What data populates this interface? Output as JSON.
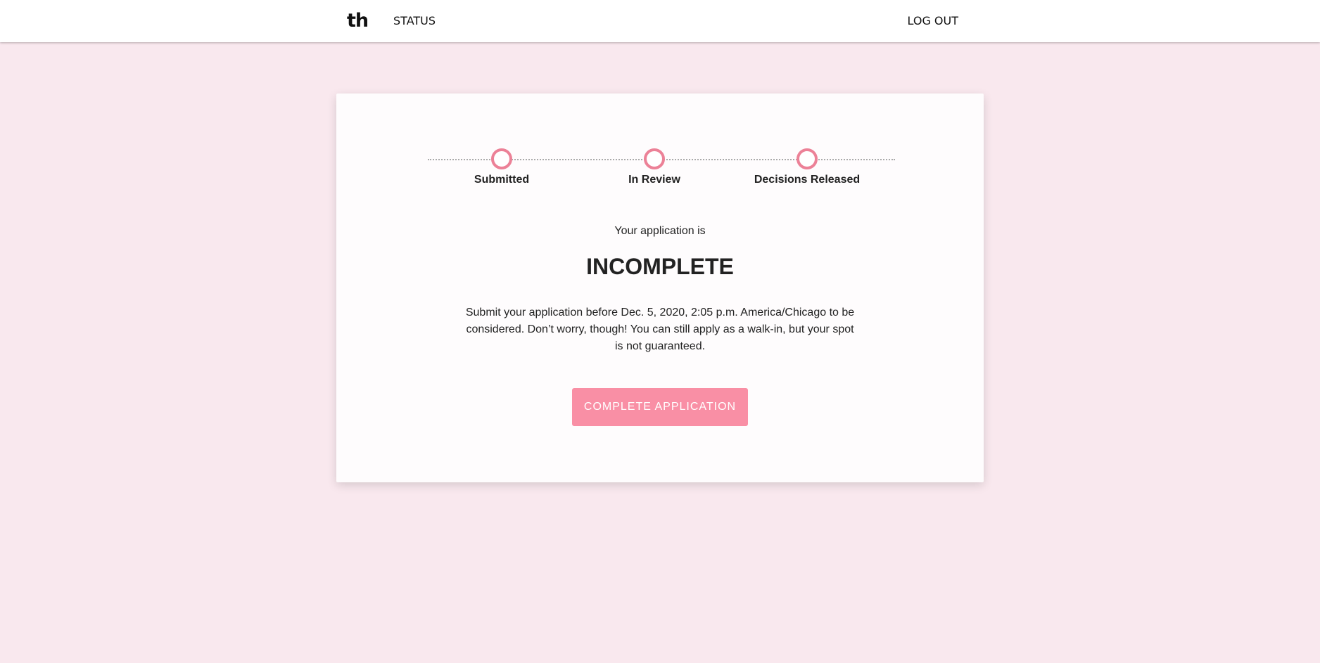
{
  "nav": {
    "logo_text": "th",
    "status_label": "STATUS",
    "logout_label": "LOG OUT"
  },
  "stepper": {
    "steps": [
      {
        "label": "Submitted"
      },
      {
        "label": "In Review"
      },
      {
        "label": "Decisions Released"
      }
    ]
  },
  "application": {
    "intro": "Your application is",
    "status": "INCOMPLETE",
    "message": "Submit your application before Dec. 5, 2020, 2:05 p.m. America/Chicago to be considered. Don’t worry, though! You can still apply as a walk-in, but your spot is not guaranteed.",
    "cta_label": "COMPLETE APPLICATION"
  },
  "colors": {
    "page_background": "#f9e8ee",
    "card_background": "#fefcfd",
    "accent": "#f98fa5",
    "step_ring": "#ec8197",
    "text": "#222222"
  }
}
